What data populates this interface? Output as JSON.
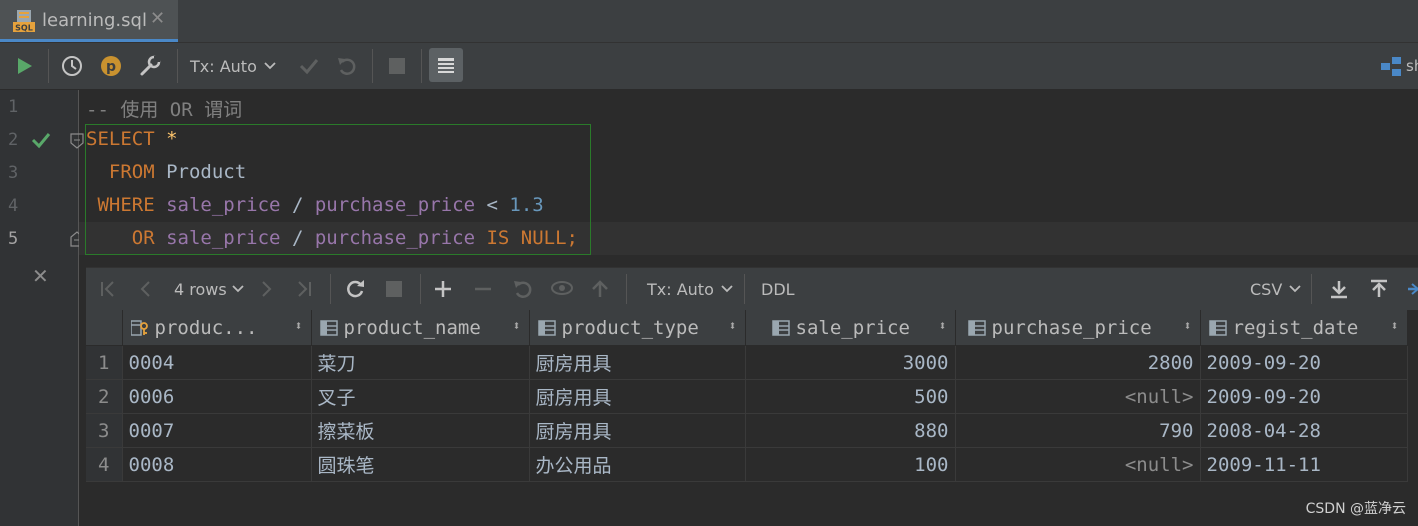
{
  "tab": {
    "title": "learning.sql",
    "close": "✕"
  },
  "toolbar": {
    "tx_mode": "Tx: Auto",
    "right_label": "sh"
  },
  "editor": {
    "line_numbers": [
      "1",
      "2",
      "3",
      "4",
      "5"
    ],
    "comment": "-- 使用 OR 谓词",
    "select_kw": "SELECT",
    "star": "*",
    "from_kw": "FROM",
    "table": "Product",
    "where_kw": "WHERE",
    "col_sale": "sale_price",
    "div": "/",
    "col_purchase": "purchase_price",
    "lt": "<",
    "value": "1.3",
    "or_kw": "OR",
    "is_null_kw": "IS NULL",
    "semicolon": ";"
  },
  "results": {
    "toolbar": {
      "rows": "4 rows",
      "tx_mode": "Tx: Auto",
      "ddl": "DDL",
      "export_format": "CSV"
    },
    "columns": [
      "produc...",
      "product_name",
      "product_type",
      "sale_price",
      "purchase_price",
      "regist_date"
    ],
    "rows": [
      {
        "n": "1",
        "id": "0004",
        "name": "菜刀",
        "type": "厨房用具",
        "sale": "3000",
        "purchase": "2800",
        "date": "2009-09-20"
      },
      {
        "n": "2",
        "id": "0006",
        "name": "叉子",
        "type": "厨房用具",
        "sale": "500",
        "purchase": "<null>",
        "date": "2009-09-20"
      },
      {
        "n": "3",
        "id": "0007",
        "name": "擦菜板",
        "type": "厨房用具",
        "sale": "880",
        "purchase": "790",
        "date": "2008-04-28"
      },
      {
        "n": "4",
        "id": "0008",
        "name": "圆珠笔",
        "type": "办公用品",
        "sale": "100",
        "purchase": "<null>",
        "date": "2009-11-11"
      }
    ]
  },
  "watermark": "CSDN @蓝净云",
  "colors": {
    "keyword": "#cc7832",
    "identifier": "#9876aa",
    "number": "#6897bb",
    "run": "#59a869",
    "accent": "#4a88c7"
  }
}
